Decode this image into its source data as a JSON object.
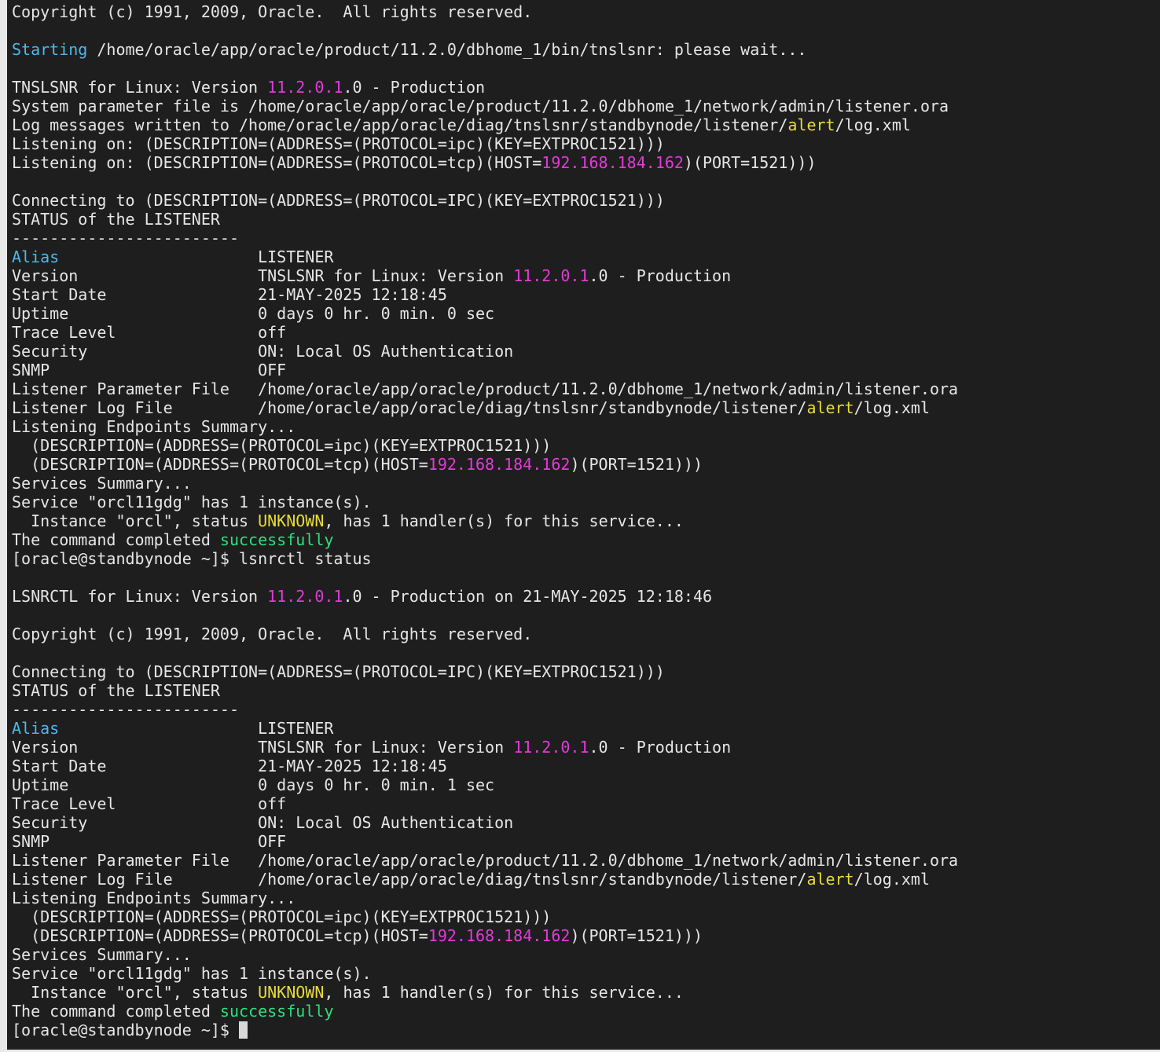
{
  "terminal": {
    "background": "#1e1e1e",
    "colors": {
      "cyan": "#4fb8e8",
      "magenta": "#e23bd8",
      "yellow": "#e8dc3a",
      "green": "#2ee07a"
    },
    "lines": [
      [
        {
          "t": "Copyright (c) 1991, 2009, Oracle.  All rights reserved."
        }
      ],
      [],
      [
        {
          "t": "Starting",
          "c": "cyan"
        },
        {
          "t": " /home/oracle/app/oracle/product/11.2.0/dbhome_1/bin/tnslsnr: please wait..."
        }
      ],
      [],
      [
        {
          "t": "TNSLSNR for Linux: Version "
        },
        {
          "t": "11.2.0.1",
          "c": "magenta"
        },
        {
          "t": ".0 - Production"
        }
      ],
      [
        {
          "t": "System parameter file is /home/oracle/app/oracle/product/11.2.0/dbhome_1/network/admin/listener.ora"
        }
      ],
      [
        {
          "t": "Log messages written to /home/oracle/app/oracle/diag/tnslsnr/standbynode/listener/"
        },
        {
          "t": "alert",
          "c": "yellow"
        },
        {
          "t": "/log.xml"
        }
      ],
      [
        {
          "t": "Listening on: (DESCRIPTION=(ADDRESS=(PROTOCOL=ipc)(KEY=EXTPROC1521)))"
        }
      ],
      [
        {
          "t": "Listening on: (DESCRIPTION=(ADDRESS=(PROTOCOL=tcp)(HOST="
        },
        {
          "t": "192.168.184.162",
          "c": "magenta"
        },
        {
          "t": ")(PORT=1521)))"
        }
      ],
      [],
      [
        {
          "t": "Connecting to (DESCRIPTION=(ADDRESS=(PROTOCOL=IPC)(KEY=EXTPROC1521)))"
        }
      ],
      [
        {
          "t": "STATUS of the LISTENER"
        }
      ],
      [
        {
          "t": "------------------------"
        }
      ],
      [
        {
          "t": "Alias",
          "c": "cyan"
        },
        {
          "t": "                     LISTENER"
        }
      ],
      [
        {
          "t": "Version                   TNSLSNR for Linux: Version "
        },
        {
          "t": "11.2.0.1",
          "c": "magenta"
        },
        {
          "t": ".0 - Production"
        }
      ],
      [
        {
          "t": "Start Date                21-MAY-2025 12:18:45"
        }
      ],
      [
        {
          "t": "Uptime                    0 days 0 hr. 0 min. 0 sec"
        }
      ],
      [
        {
          "t": "Trace Level               off"
        }
      ],
      [
        {
          "t": "Security                  ON: Local OS Authentication"
        }
      ],
      [
        {
          "t": "SNMP                      OFF"
        }
      ],
      [
        {
          "t": "Listener Parameter File   /home/oracle/app/oracle/product/11.2.0/dbhome_1/network/admin/listener.ora"
        }
      ],
      [
        {
          "t": "Listener Log File         /home/oracle/app/oracle/diag/tnslsnr/standbynode/listener/"
        },
        {
          "t": "alert",
          "c": "yellow"
        },
        {
          "t": "/log.xml"
        }
      ],
      [
        {
          "t": "Listening Endpoints Summary..."
        }
      ],
      [
        {
          "t": "  (DESCRIPTION=(ADDRESS=(PROTOCOL=ipc)(KEY=EXTPROC1521)))"
        }
      ],
      [
        {
          "t": "  (DESCRIPTION=(ADDRESS=(PROTOCOL=tcp)(HOST="
        },
        {
          "t": "192.168.184.162",
          "c": "magenta"
        },
        {
          "t": ")(PORT=1521)))"
        }
      ],
      [
        {
          "t": "Services Summary..."
        }
      ],
      [
        {
          "t": "Service \"orcl11gdg\" has 1 instance(s)."
        }
      ],
      [
        {
          "t": "  Instance \"orcl\", status "
        },
        {
          "t": "UNKNOWN",
          "c": "yellow"
        },
        {
          "t": ", has 1 handler(s) for this service..."
        }
      ],
      [
        {
          "t": "The command completed "
        },
        {
          "t": "successfully",
          "c": "green"
        }
      ],
      [
        {
          "t": "[oracle@standbynode ~]$ lsnrctl status"
        }
      ],
      [],
      [
        {
          "t": "LSNRCTL for Linux: Version "
        },
        {
          "t": "11.2.0.1",
          "c": "magenta"
        },
        {
          "t": ".0 - Production on 21-MAY-2025 12:18:46"
        }
      ],
      [],
      [
        {
          "t": "Copyright (c) 1991, 2009, Oracle.  All rights reserved."
        }
      ],
      [],
      [
        {
          "t": "Connecting to (DESCRIPTION=(ADDRESS=(PROTOCOL=IPC)(KEY=EXTPROC1521)))"
        }
      ],
      [
        {
          "t": "STATUS of the LISTENER"
        }
      ],
      [
        {
          "t": "------------------------"
        }
      ],
      [
        {
          "t": "Alias",
          "c": "cyan"
        },
        {
          "t": "                     LISTENER"
        }
      ],
      [
        {
          "t": "Version                   TNSLSNR for Linux: Version "
        },
        {
          "t": "11.2.0.1",
          "c": "magenta"
        },
        {
          "t": ".0 - Production"
        }
      ],
      [
        {
          "t": "Start Date                21-MAY-2025 12:18:45"
        }
      ],
      [
        {
          "t": "Uptime                    0 days 0 hr. 0 min. 1 sec"
        }
      ],
      [
        {
          "t": "Trace Level               off"
        }
      ],
      [
        {
          "t": "Security                  ON: Local OS Authentication"
        }
      ],
      [
        {
          "t": "SNMP                      OFF"
        }
      ],
      [
        {
          "t": "Listener Parameter File   /home/oracle/app/oracle/product/11.2.0/dbhome_1/network/admin/listener.ora"
        }
      ],
      [
        {
          "t": "Listener Log File         /home/oracle/app/oracle/diag/tnslsnr/standbynode/listener/"
        },
        {
          "t": "alert",
          "c": "yellow"
        },
        {
          "t": "/log.xml"
        }
      ],
      [
        {
          "t": "Listening Endpoints Summary..."
        }
      ],
      [
        {
          "t": "  (DESCRIPTION=(ADDRESS=(PROTOCOL=ipc)(KEY=EXTPROC1521)))"
        }
      ],
      [
        {
          "t": "  (DESCRIPTION=(ADDRESS=(PROTOCOL=tcp)(HOST="
        },
        {
          "t": "192.168.184.162",
          "c": "magenta"
        },
        {
          "t": ")(PORT=1521)))"
        }
      ],
      [
        {
          "t": "Services Summary..."
        }
      ],
      [
        {
          "t": "Service \"orcl11gdg\" has 1 instance(s)."
        }
      ],
      [
        {
          "t": "  Instance \"orcl\", status "
        },
        {
          "t": "UNKNOWN",
          "c": "yellow"
        },
        {
          "t": ", has 1 handler(s) for this service..."
        }
      ],
      [
        {
          "t": "The command completed "
        },
        {
          "t": "successfully",
          "c": "green"
        }
      ]
    ],
    "prompt": "[oracle@standbynode ~]$ "
  }
}
